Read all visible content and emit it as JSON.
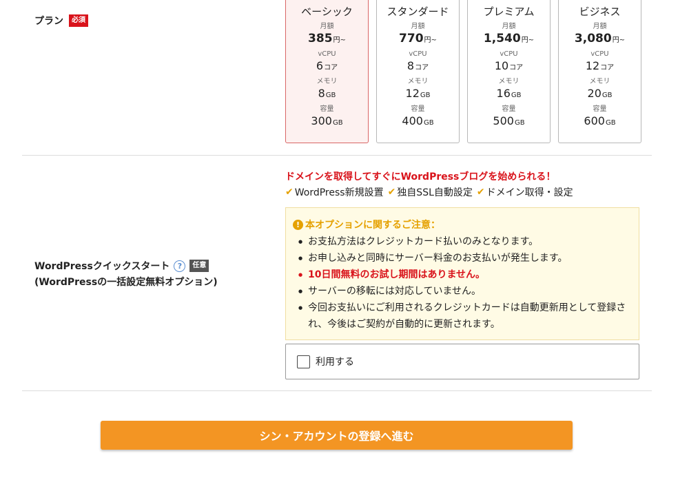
{
  "plan": {
    "label": "プラン",
    "required_badge": "必須",
    "cards": [
      {
        "name": "ベーシック",
        "price_label": "月額",
        "price": "385",
        "price_unit": "円~",
        "cpu_label": "vCPU",
        "cpu": "6",
        "cpu_unit": "コア",
        "mem_label": "メモリ",
        "mem": "8",
        "mem_unit": "GB",
        "disk_label": "容量",
        "disk": "300",
        "disk_unit": "GB",
        "selected": true
      },
      {
        "name": "スタンダード",
        "price_label": "月額",
        "price": "770",
        "price_unit": "円~",
        "cpu_label": "vCPU",
        "cpu": "8",
        "cpu_unit": "コア",
        "mem_label": "メモリ",
        "mem": "12",
        "mem_unit": "GB",
        "disk_label": "容量",
        "disk": "400",
        "disk_unit": "GB",
        "selected": false
      },
      {
        "name": "プレミアム",
        "price_label": "月額",
        "price": "1,540",
        "price_unit": "円~",
        "cpu_label": "vCPU",
        "cpu": "10",
        "cpu_unit": "コア",
        "mem_label": "メモリ",
        "mem": "16",
        "mem_unit": "GB",
        "disk_label": "容量",
        "disk": "500",
        "disk_unit": "GB",
        "selected": false
      },
      {
        "name": "ビジネス",
        "price_label": "月額",
        "price": "3,080",
        "price_unit": "円~",
        "cpu_label": "vCPU",
        "cpu": "12",
        "cpu_unit": "コア",
        "mem_label": "メモリ",
        "mem": "20",
        "mem_unit": "GB",
        "disk_label": "容量",
        "disk": "600",
        "disk_unit": "GB",
        "selected": false
      }
    ]
  },
  "wordpress": {
    "label_line1": "WordPressクイックスタート",
    "help_icon": "?",
    "optional_badge": "任意",
    "label_line2": "(WordPressの一括設定無料オプション)",
    "promo": "ドメインを取得してすぐにWordPressブログを始められる！",
    "check_icon": "✔",
    "features": [
      "WordPress新規設置",
      "独自SSL自動設定",
      "ドメイン取得・設定"
    ],
    "notice": {
      "alert_icon": "!",
      "title": "本オプションに関するご注意：",
      "items": [
        {
          "text": "お支払方法はクレジットカード払いのみとなります。",
          "emphasis": false
        },
        {
          "text": "お申し込みと同時にサーバー料金のお支払いが発生します。",
          "emphasis": false
        },
        {
          "text": "10日間無料のお試し期間はありません。",
          "emphasis": true
        },
        {
          "text": "サーバーの移転には対応していません。",
          "emphasis": false
        },
        {
          "text": "今回お支払いにご利用されるクレジットカードは自動更新用として登録され、今後はご契約が自動的に更新されます。",
          "emphasis": false
        }
      ]
    },
    "use_checkbox_label": "利用する",
    "use_checked": false
  },
  "submit": {
    "label": "シン・アカウントの登録へ進む"
  },
  "colors": {
    "required_red": "#d9131b",
    "accent_orange": "#f39523",
    "check_yellow": "#e5a100",
    "selected_card_bg": "#fdf1f0",
    "notice_bg": "#fffbe5"
  }
}
